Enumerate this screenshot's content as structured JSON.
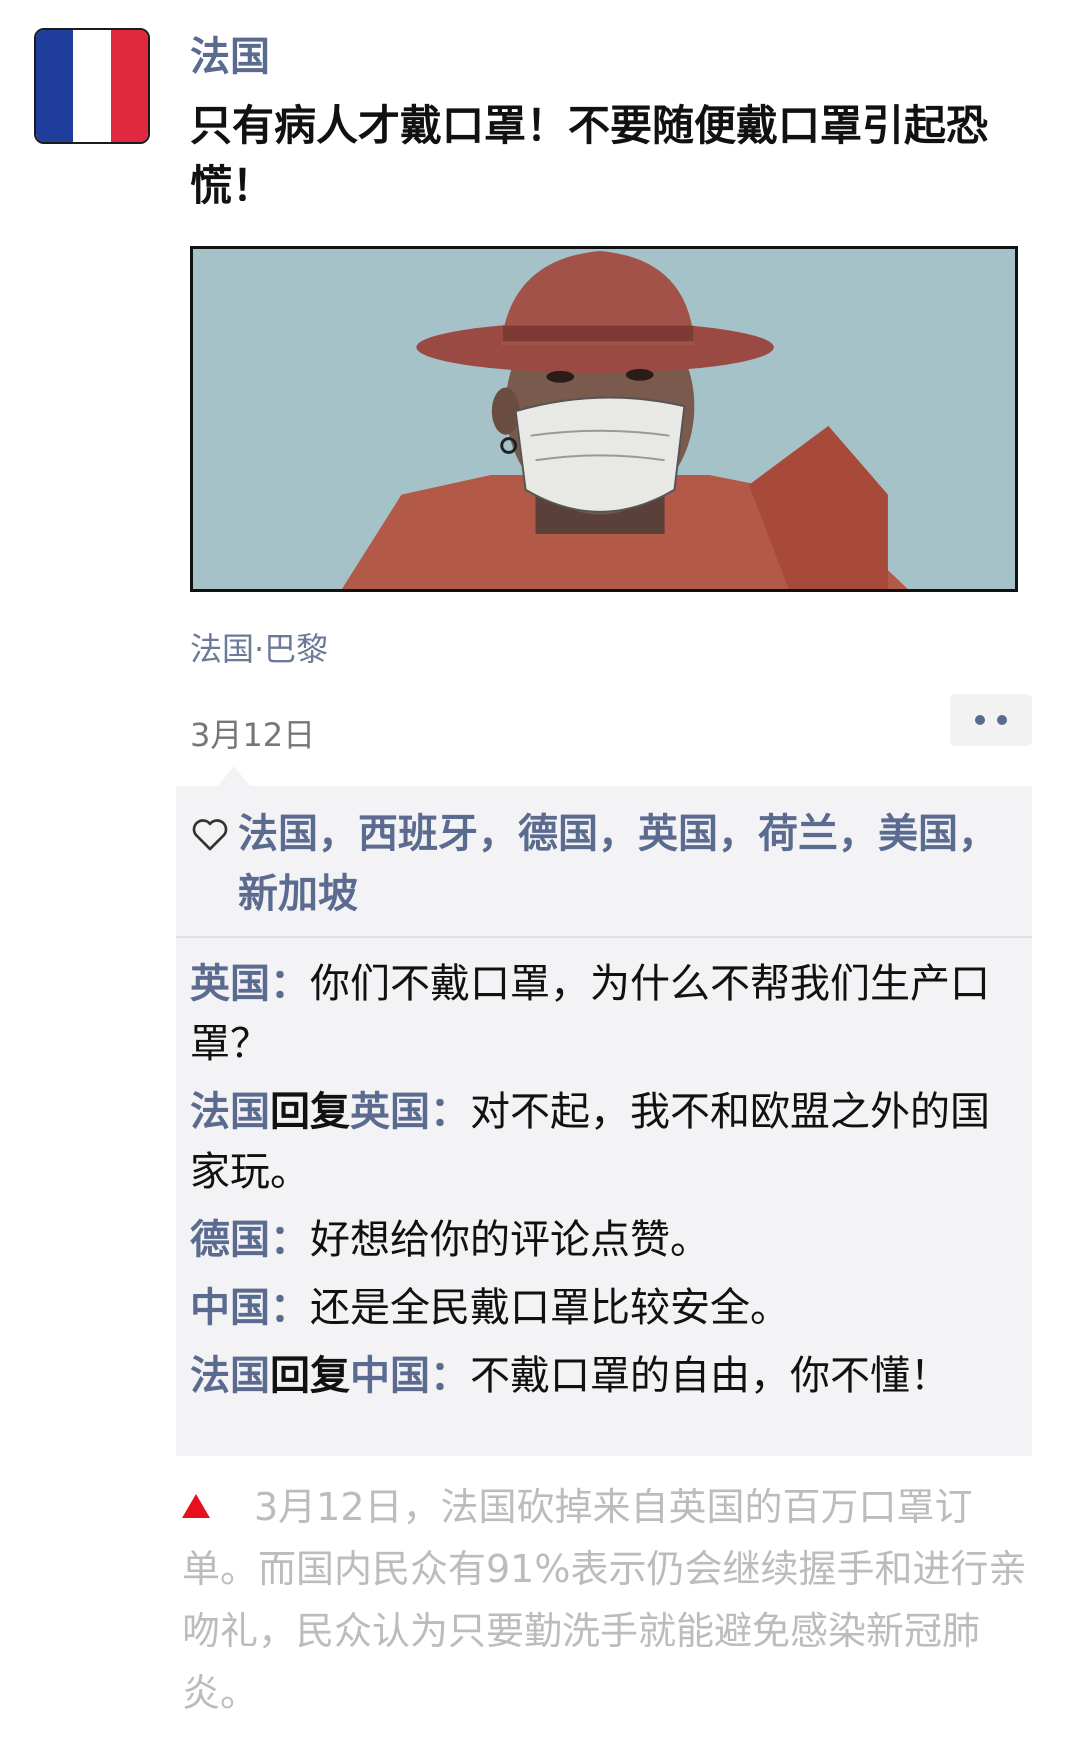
{
  "post": {
    "author": "法国",
    "avatar_icon": "france-flag-icon",
    "flag_colors": [
      "#1f3d9a",
      "#ffffff",
      "#e0283e"
    ],
    "text": "只有病人才戴口罩！不要随便戴口罩引起恐慌！",
    "location": "法国·巴黎",
    "date": "3月12日",
    "more_icon": "more-dots-icon"
  },
  "likes": {
    "icon": "heart-icon",
    "names": "法国，西班牙，德国，英国，荷兰，美国，新加坡"
  },
  "comments": [
    {
      "author": "英国",
      "reply_word": "",
      "reply_to": "",
      "sep": "：",
      "text": "你们不戴口罩，为什么不帮我们生产口罩？"
    },
    {
      "author": "法国",
      "reply_word": "回复",
      "reply_to": "英国",
      "sep": "：",
      "text": "对不起，我不和欧盟之外的国家玩。"
    },
    {
      "author": "德国",
      "reply_word": "",
      "reply_to": "",
      "sep": "：",
      "text": "好想给你的评论点赞。"
    },
    {
      "author": "中国",
      "reply_word": "",
      "reply_to": "",
      "sep": "：",
      "text": "还是全民戴口罩比较安全。"
    },
    {
      "author": "法国",
      "reply_word": "回复",
      "reply_to": "中国",
      "sep": "：",
      "text": "不戴口罩的自由，你不懂！"
    }
  ],
  "caption": {
    "marker_icon": "red-triangle-icon",
    "marker_color": "#e8101c",
    "text": "3月12日，法国砍掉来自英国的百万口罩订单。而国内民众有91%表示仍会继续握手和进行亲吻礼，民众认为只要勤洗手就能避免感染新冠肺炎。"
  }
}
